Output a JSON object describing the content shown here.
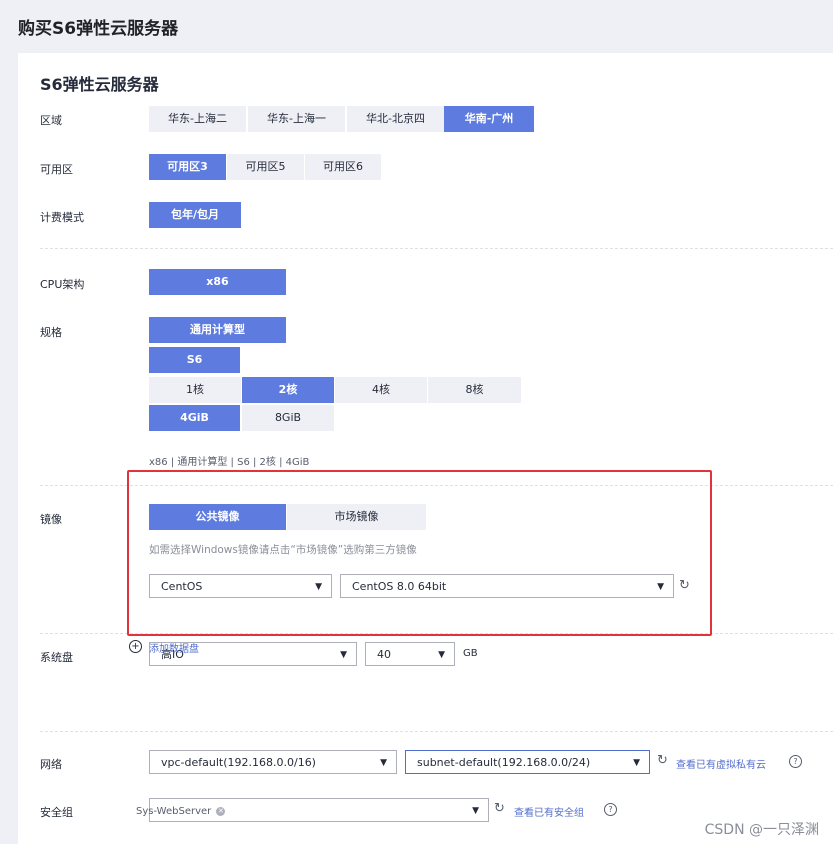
{
  "page_title": "购买S6弹性云服务器",
  "card_title": "S6弹性云服务器",
  "region": {
    "label": "区域",
    "options": [
      "华东-上海二",
      "华东-上海一",
      "华北-北京四",
      "华南-广州"
    ],
    "selected": 3
  },
  "az": {
    "label": "可用区",
    "options": [
      "可用区3",
      "可用区5",
      "可用区6"
    ],
    "selected": 0
  },
  "billing": {
    "label": "计费模式",
    "options": [
      "包年/包月"
    ],
    "selected": 0
  },
  "cpu": {
    "label": "CPU架构",
    "options": [
      "x86"
    ],
    "selected": 0
  },
  "spec": {
    "label": "规格",
    "type_option": "通用计算型",
    "series_option": "S6",
    "vcpu_options": [
      "1核",
      "2核",
      "4核",
      "8核"
    ],
    "vcpu_selected": 1,
    "mem_options": [
      "4GiB",
      "8GiB"
    ],
    "mem_selected": 0,
    "summary": "x86 | 通用计算型 | S6 | 2核 | 4GiB"
  },
  "image": {
    "label": "镜像",
    "tabs": [
      "公共镜像",
      "市场镜像"
    ],
    "selected_tab": 0,
    "hint": "如需选择Windows镜像请点击“市场镜像”选购第三方镜像",
    "os": "CentOS",
    "version": "CentOS 8.0 64bit"
  },
  "disk": {
    "label": "系统盘",
    "type": "高IO",
    "size": "40",
    "unit": "GB",
    "add_label": "添加数据盘"
  },
  "network": {
    "label": "网络",
    "vpc": "vpc-default(192.168.0.0/16)",
    "subnet": "subnet-default(192.168.0.0/24)",
    "link": "查看已有虚拟私有云"
  },
  "security": {
    "label": "安全组",
    "tag": "Sys-WebServer",
    "link": "查看已有安全组"
  },
  "watermark": "CSDN @一只泽渊",
  "colors": {
    "accent": "#5e7ce0",
    "highlight": "#e0333a",
    "link": "#526ecc"
  },
  "icons": {
    "dropdown": "chevron-down-icon",
    "refresh": "refresh-icon",
    "help": "help-icon",
    "add": "add-circle-icon",
    "tag_close": "close-icon"
  }
}
